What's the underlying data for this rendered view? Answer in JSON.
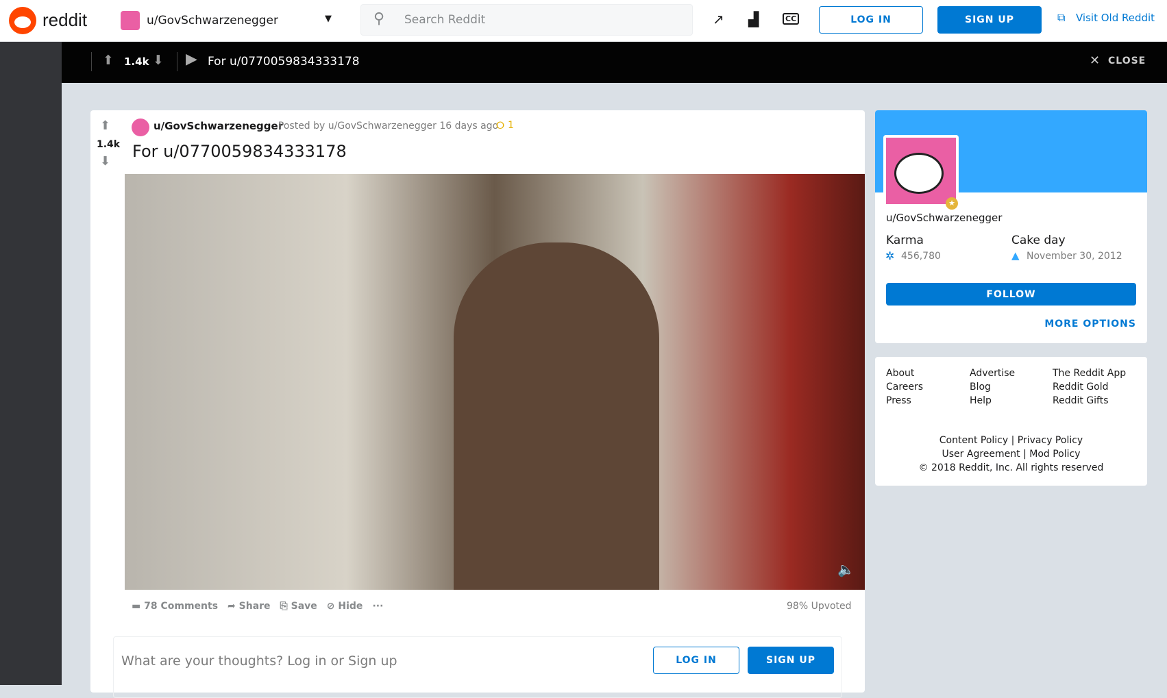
{
  "header": {
    "brand": "reddit",
    "community": "u/GovSchwarzenegger",
    "search_placeholder": "Search Reddit",
    "login": "LOG IN",
    "signup": "SIGN UP",
    "old_reddit": "Visit Old Reddit"
  },
  "topbar": {
    "votes": "1.4k",
    "title": "For u/0770059834333178",
    "close": "CLOSE"
  },
  "post": {
    "author": "u/GovSchwarzenegger",
    "posted_by": "· Posted by u/GovSchwarzenegger 16 days ago",
    "awards": "1",
    "votes": "1.4k",
    "title": "For u/0770059834333178",
    "comments": "78 Comments",
    "share": "Share",
    "save": "Save",
    "hide": "Hide",
    "more": "···",
    "upvoted": "98% Upvoted",
    "comment_placeholder": "What are your thoughts? Log in or Sign up",
    "login": "LOG IN",
    "signup": "SIGN UP"
  },
  "profile": {
    "name": "u/GovSchwarzenegger",
    "karma_label": "Karma",
    "karma": "456,780",
    "cake_label": "Cake day",
    "cake": "November 30, 2012",
    "follow": "FOLLOW",
    "more": "MORE OPTIONS",
    "banner_color": "#33a8ff",
    "avatar_color": "#ea5fa4"
  },
  "footer": {
    "col1": [
      "About",
      "Careers",
      "Press"
    ],
    "col2": [
      "Advertise",
      "Blog",
      "Help"
    ],
    "col3": [
      "The Reddit App",
      "Reddit Gold",
      "Reddit Gifts"
    ],
    "content_policy": "Content Policy |",
    "privacy": "Privacy Policy",
    "user_agreement": "User Agreement |",
    "mod_policy": "Mod Policy",
    "copyright": "© 2018 Reddit, Inc. All rights reserved"
  }
}
